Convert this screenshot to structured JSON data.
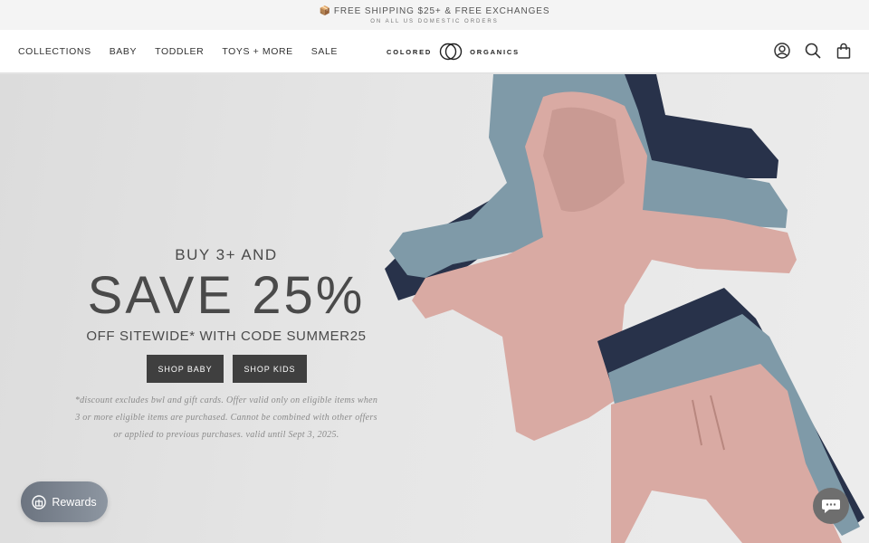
{
  "announcement": {
    "icon": "package-icon",
    "main": "FREE SHIPPING $25+ & FREE EXCHANGES",
    "sub": "ON ALL US DOMESTIC ORDERS"
  },
  "nav": {
    "links": [
      "COLLECTIONS",
      "BABY",
      "TODDLER",
      "TOYS + MORE",
      "SALE"
    ],
    "logo_left": "COLORED",
    "logo_right": "ORGANICS",
    "icons": [
      "account-icon",
      "search-icon",
      "bag-icon"
    ]
  },
  "hero": {
    "line1": "BUY 3+ AND",
    "line2": "SAVE 25%",
    "line3": "OFF SITEWIDE* WITH CODE SUMMER25",
    "button_baby": "SHOP BABY",
    "button_kids": "SHOP KIDS",
    "disclaimer": "*discount excludes bwl and gift cards. Offer valid only on eligible items when 3 or more eligible items are purchased. Cannot be combined with other offers or applied to previous purchases. valid until Sept 3, 2025."
  },
  "widgets": {
    "rewards_label": "Rewards",
    "chat_icon": "chat-icon"
  },
  "colors": {
    "button": "#3f3f3f",
    "pink": "#d9aaa3",
    "navy": "#28324a",
    "blue": "#7f9aa8"
  }
}
